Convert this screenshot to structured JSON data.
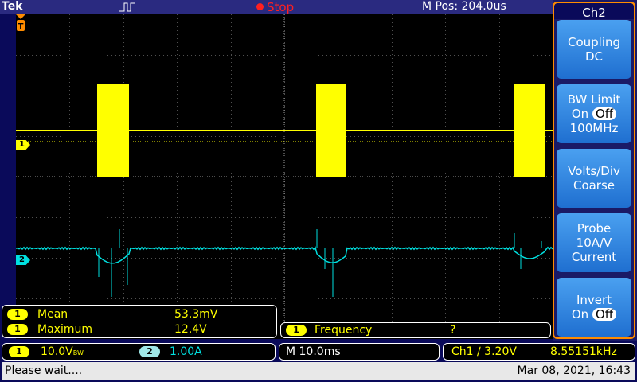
{
  "topbar": {
    "brand": "Tek",
    "run_state": "Stop",
    "m_pos": "M Pos: 204.0us",
    "colors": {
      "run_state": "#ff2020"
    }
  },
  "markers": {
    "ch1": "1",
    "ch2": "2",
    "trigger": "T"
  },
  "side_panel": {
    "title": "Ch2",
    "buttons": [
      {
        "line1": "Coupling",
        "line2": "DC"
      },
      {
        "line1": "BW Limit",
        "on": "On",
        "off": "Off",
        "line3": "100MHz"
      },
      {
        "line1": "Volts/Div",
        "line2": "Coarse"
      },
      {
        "line1": "Probe",
        "line2": "10A/V",
        "line3": "Current"
      },
      {
        "line1": "Invert",
        "on": "On",
        "off": "Off"
      }
    ]
  },
  "measurements": [
    {
      "channel": "1",
      "name": "Mean",
      "value": "53.3mV"
    },
    {
      "channel": "1",
      "name": "Maximum",
      "value": "12.4V"
    }
  ],
  "frequency": {
    "channel": "1",
    "name": "Frequency",
    "value": "?"
  },
  "channel_info": {
    "ch1_badge": "1",
    "ch1_scale": "10.0V",
    "ch1_suffix": "BW",
    "ch2_badge": "2",
    "ch2_scale": "1.00A"
  },
  "timebase": "M 10.0ms",
  "trigger_info": {
    "label": "Ch1 ∕ 3.20V",
    "freq": "8.55151kHz"
  },
  "status": {
    "message": "Please wait....",
    "datetime": "Mar 08, 2021, 16:43"
  },
  "colors": {
    "ch1": "#ffff00",
    "ch2": "#00e0e0",
    "accent": "#ff8c00"
  }
}
